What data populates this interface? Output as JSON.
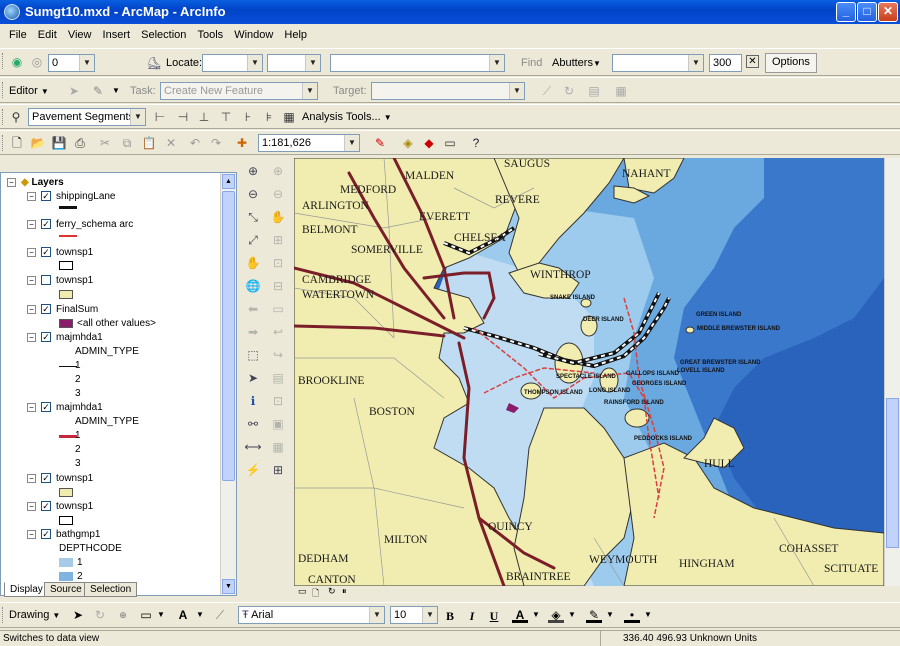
{
  "window": {
    "title": "Sumgt10.mxd - ArcMap - ArcInfo",
    "min_label": "_",
    "max_label": "□",
    "close_label": "✕"
  },
  "menu": [
    "File",
    "Edit",
    "View",
    "Insert",
    "Selection",
    "Tools",
    "Window",
    "Help"
  ],
  "locator_toolbar": {
    "layer_value": "0",
    "locate_label": "Locate:",
    "find_label": "Find",
    "abutters_label": "Abutters",
    "distance_value": "300",
    "options_label": "Options"
  },
  "editor_toolbar": {
    "editor_label": "Editor",
    "task_label": "Task:",
    "task_value": "Create New Feature",
    "target_label": "Target:"
  },
  "segments_toolbar": {
    "layer_value": "Pavement Segments",
    "analysis_label": "Analysis Tools..."
  },
  "standard_toolbar": {
    "scale_value": "1:181,626"
  },
  "toc": {
    "root": "Layers",
    "layers": [
      {
        "name": "shippingLane",
        "checked": true
      },
      {
        "name": "ferry_schema arc",
        "checked": true
      },
      {
        "name": "townsp1",
        "checked": true
      },
      {
        "name": "townsp1",
        "checked": false
      },
      {
        "name": "FinalSum",
        "checked": true,
        "legend": "<all other values>"
      },
      {
        "name": "majmhda1",
        "checked": true,
        "field": "ADMIN_TYPE",
        "classes": [
          "1",
          "2",
          "3"
        ]
      },
      {
        "name": "majmhda1",
        "checked": true,
        "field": "ADMIN_TYPE",
        "classes": [
          "1",
          "2",
          "3"
        ]
      },
      {
        "name": "townsp1",
        "checked": true
      },
      {
        "name": "townsp1",
        "checked": true
      },
      {
        "name": "bathgmp1",
        "checked": true,
        "field": "DEPTHCODE",
        "classes": [
          "1",
          "2"
        ]
      }
    ],
    "tabs": [
      "Display",
      "Source",
      "Selection"
    ]
  },
  "map": {
    "towns": [
      "MALDEN",
      "REVERE",
      "MEDFORD",
      "ARLINGTON",
      "EVERETT",
      "BELMONT",
      "SOMERVILLE",
      "CHELSEA",
      "CAMBRIDGE",
      "WATERTOWN",
      "WINTHROP",
      "BROOKLINE",
      "BOSTON",
      "QUINCY",
      "MILTON",
      "DEDHAM",
      "CANTON",
      "BRAINTREE",
      "WEYMOUTH",
      "HINGHAM",
      "COHASSET",
      "SCITUATE",
      "HULL",
      "NAHANT",
      "SAUGUS"
    ],
    "islands": [
      "SNAKE ISLAND",
      "DEER ISLAND",
      "GREEN ISLAND",
      "MIDDLE BREWSTER ISLAND",
      "GREAT BREWSTER ISLAND",
      "LOVELL ISLAND",
      "GALLOPS ISLAND",
      "GEORGES ISLAND",
      "SPECTACLE ISLAND",
      "THOMPSON ISLAND",
      "LONG ISLAND",
      "RAINSFORD ISLAND",
      "PEDDOCKS ISLAND"
    ]
  },
  "draw_toolbar": {
    "drawing_label": "Drawing",
    "font_value": "Arial",
    "size_value": "10",
    "bold": "B",
    "italic": "I",
    "underline": "U"
  },
  "status": {
    "message": "Switches to data view",
    "coords": "336.40  496.93 Unknown Units"
  }
}
